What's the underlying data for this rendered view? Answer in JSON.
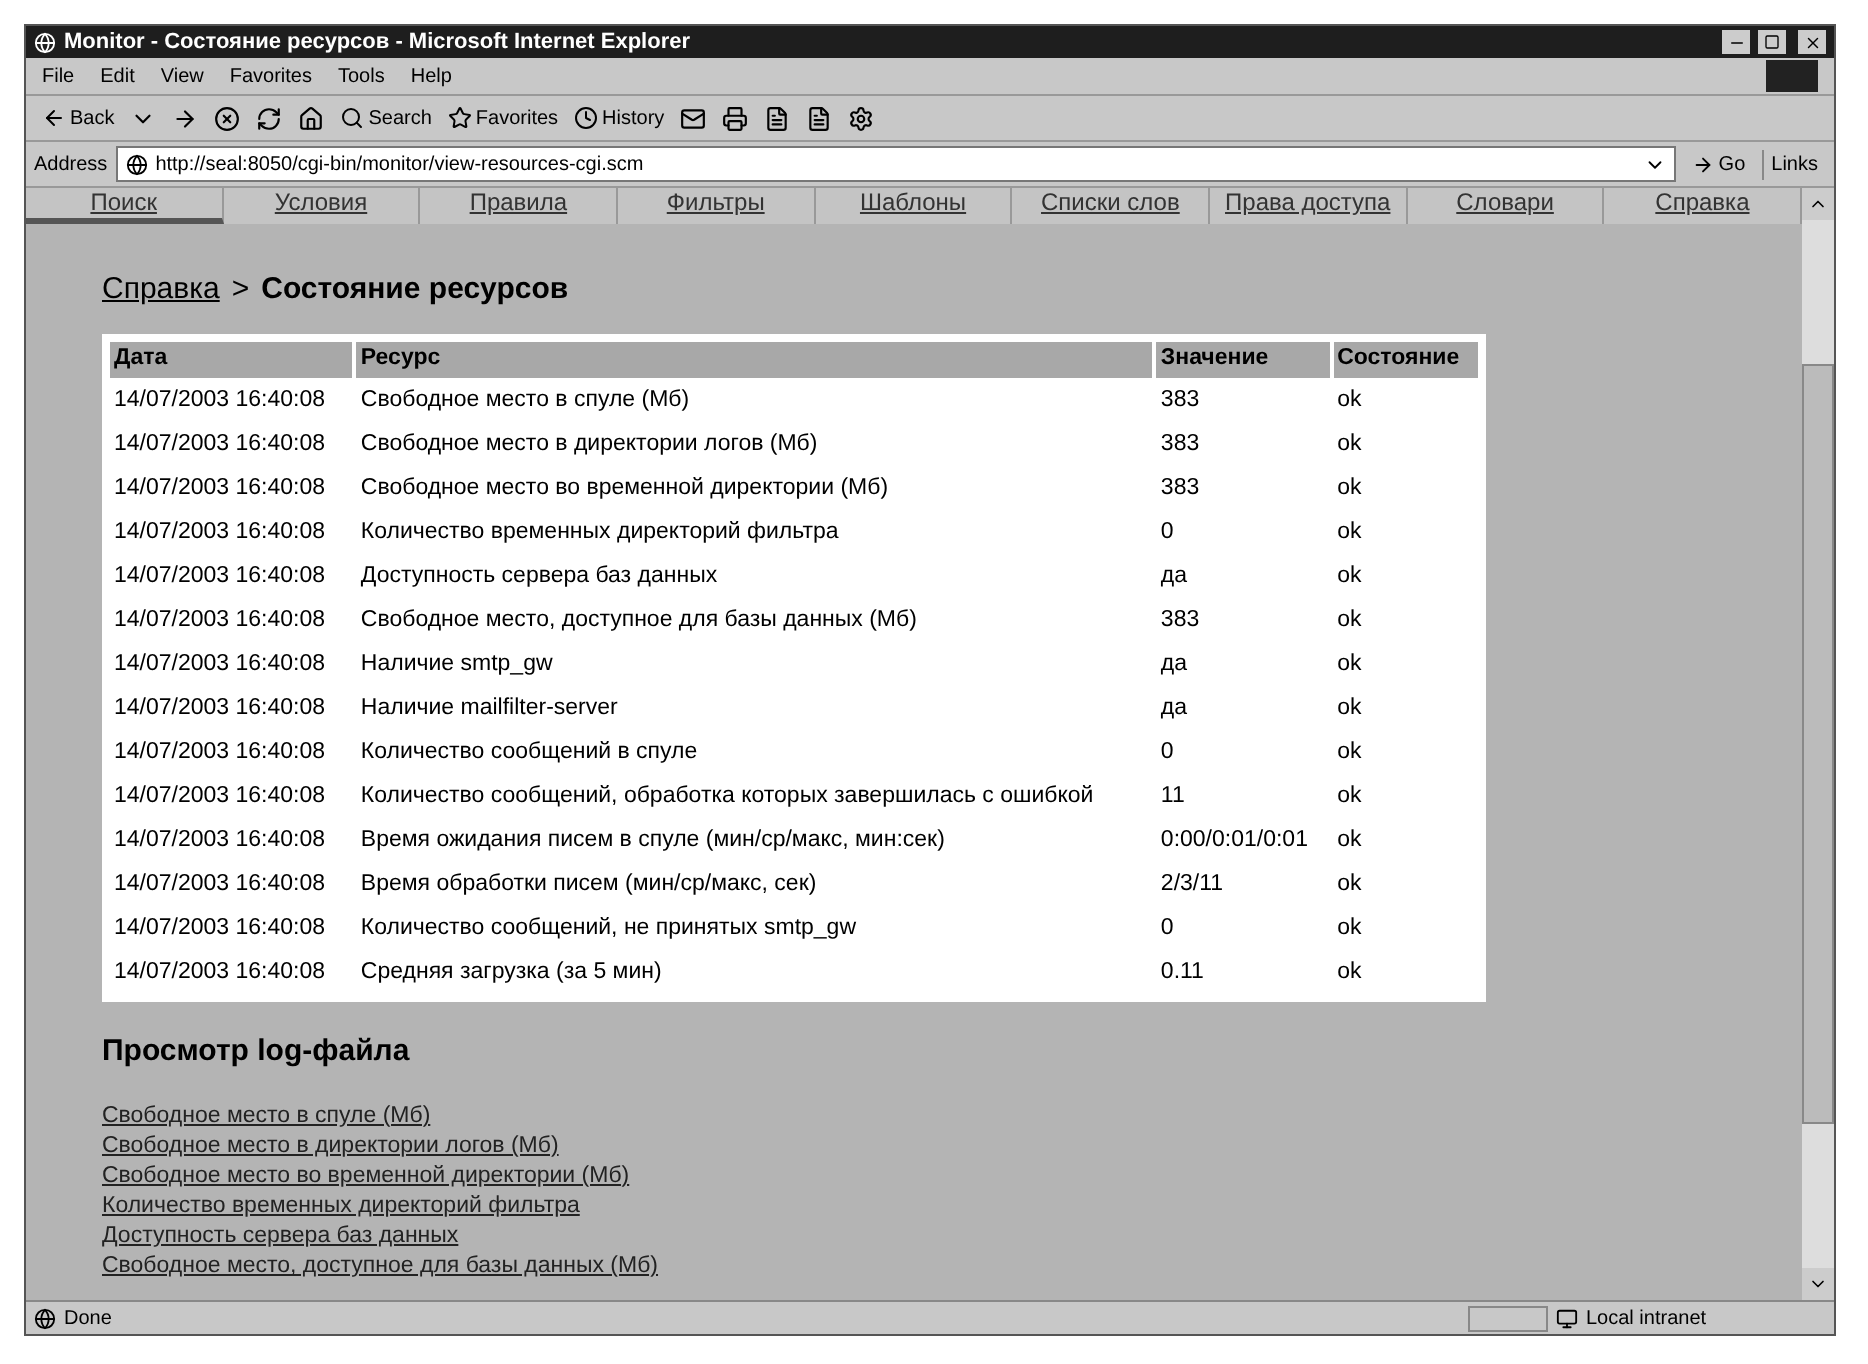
{
  "window": {
    "title": "Monitor - Состояние ресурсов - Microsoft Internet Explorer"
  },
  "menu": [
    "File",
    "Edit",
    "View",
    "Favorites",
    "Tools",
    "Help"
  ],
  "toolbar": {
    "back": "Back",
    "search": "Search",
    "favorites": "Favorites",
    "history": "History"
  },
  "address": {
    "label": "Address",
    "value": "http://seal:8050/cgi-bin/monitor/view-resources-cgi.scm",
    "go": "Go",
    "links": "Links"
  },
  "nav_tabs": [
    {
      "label": "Поиск",
      "selected": true
    },
    {
      "label": "Условия",
      "selected": false
    },
    {
      "label": "Правила",
      "selected": false
    },
    {
      "label": "Фильтры",
      "selected": false
    },
    {
      "label": "Шаблоны",
      "selected": false
    },
    {
      "label": "Списки слов",
      "selected": false
    },
    {
      "label": "Права доступа",
      "selected": false
    },
    {
      "label": "Словари",
      "selected": false
    },
    {
      "label": "Справка",
      "selected": false
    }
  ],
  "breadcrumb": {
    "link": "Справка",
    "separator": ">",
    "current": "Состояние ресурсов"
  },
  "table": {
    "columns": [
      "Дата",
      "Ресурс",
      "Значение",
      "Состояние"
    ],
    "rows": [
      [
        "14/07/2003 16:40:08",
        "Свободное место в спуле (Мб)",
        "383",
        "ok"
      ],
      [
        "14/07/2003 16:40:08",
        "Свободное место в директории логов (Мб)",
        "383",
        "ok"
      ],
      [
        "14/07/2003 16:40:08",
        "Свободное место во временной директории (Мб)",
        "383",
        "ok"
      ],
      [
        "14/07/2003 16:40:08",
        "Количество временных директорий фильтра",
        "0",
        "ok"
      ],
      [
        "14/07/2003 16:40:08",
        "Доступность сервера баз данных",
        "да",
        "ok"
      ],
      [
        "14/07/2003 16:40:08",
        "Свободное место, доступное для базы данных (Мб)",
        "383",
        "ok"
      ],
      [
        "14/07/2003 16:40:08",
        "Наличие smtp_gw",
        "да",
        "ok"
      ],
      [
        "14/07/2003 16:40:08",
        "Наличие mailfilter-server",
        "да",
        "ok"
      ],
      [
        "14/07/2003 16:40:08",
        "Количество сообщений в спуле",
        "0",
        "ok"
      ],
      [
        "14/07/2003 16:40:08",
        "Количество сообщений, обработка которых завершилась с ошибкой",
        "11",
        "ok"
      ],
      [
        "14/07/2003 16:40:08",
        "Время ожидания писем в спуле (мин/ср/макс, мин:сек)",
        "0:00/0:01/0:01",
        "ok"
      ],
      [
        "14/07/2003 16:40:08",
        "Время обработки писем (мин/ср/макс, сек)",
        "2/3/11",
        "ok"
      ],
      [
        "14/07/2003 16:40:08",
        "Количество сообщений, не принятых smtp_gw",
        "0",
        "ok"
      ],
      [
        "14/07/2003 16:40:08",
        "Средняя загрузка (за 5 мин)",
        "0.11",
        "ok"
      ]
    ]
  },
  "log_section": {
    "title": "Просмотр log-файла",
    "links": [
      "Свободное место в спуле (Мб)",
      "Свободное место в директории логов (Мб)",
      "Свободное место во временной директории (Мб)",
      "Количество временных директорий фильтра",
      "Доступность сервера баз данных",
      "Свободное место, доступное для базы данных (Мб)"
    ]
  },
  "status_bar": {
    "text": "Done",
    "zone": "Local intranet"
  }
}
